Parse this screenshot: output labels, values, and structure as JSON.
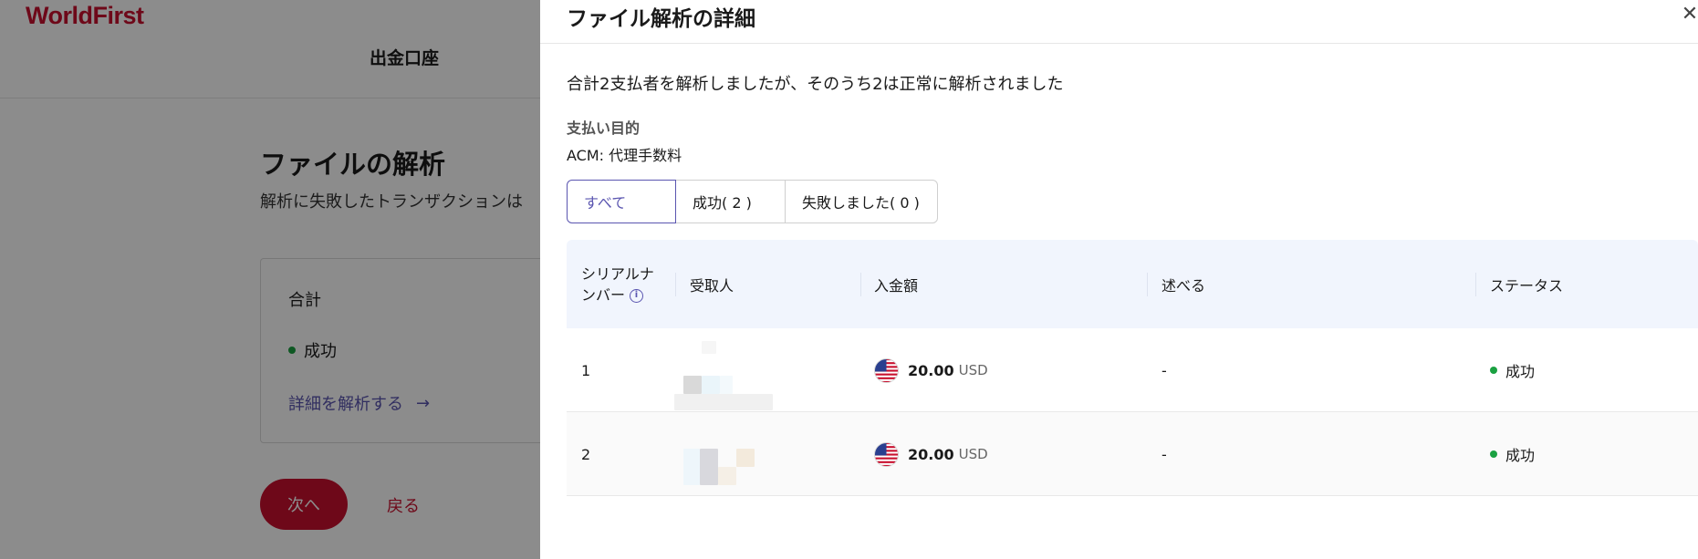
{
  "background": {
    "logo": "WorldFirst",
    "nav_title": "出金口座",
    "page_title": "ファイルの解析",
    "description": "解析に失敗したトランザクションは",
    "card": {
      "title": "合計",
      "status_label": "成功",
      "link_label": "詳細を解析する"
    },
    "next_label": "次へ",
    "back_label": "戻る"
  },
  "drawer": {
    "title": "ファイル解析の詳細",
    "summary": "合計2支払者を解析しましたが、そのうち2は正常に解析されました",
    "purpose_label": "支払い目的",
    "purpose_value": "ACM: 代理手数料",
    "tabs": [
      {
        "label": "すべて",
        "active": true
      },
      {
        "label": "成功( 2 )",
        "active": false
      },
      {
        "label": "失敗しました( 0 )",
        "active": false
      }
    ],
    "table": {
      "headers": {
        "serial_line1": "シリアルナ",
        "serial_line2": "ンバー",
        "payee": "受取人",
        "amount": "入金額",
        "description": "述べる",
        "status": "ステータス"
      },
      "rows": [
        {
          "serial": "1",
          "amount": "20.00",
          "currency": "USD",
          "description": "-",
          "status": "成功"
        },
        {
          "serial": "2",
          "amount": "20.00",
          "currency": "USD",
          "description": "-",
          "status": "成功"
        }
      ]
    }
  },
  "colors": {
    "brand": "#c8102e",
    "accent": "#5a55b0",
    "success": "#1aa141",
    "table_header_bg": "#f1f5fd"
  }
}
